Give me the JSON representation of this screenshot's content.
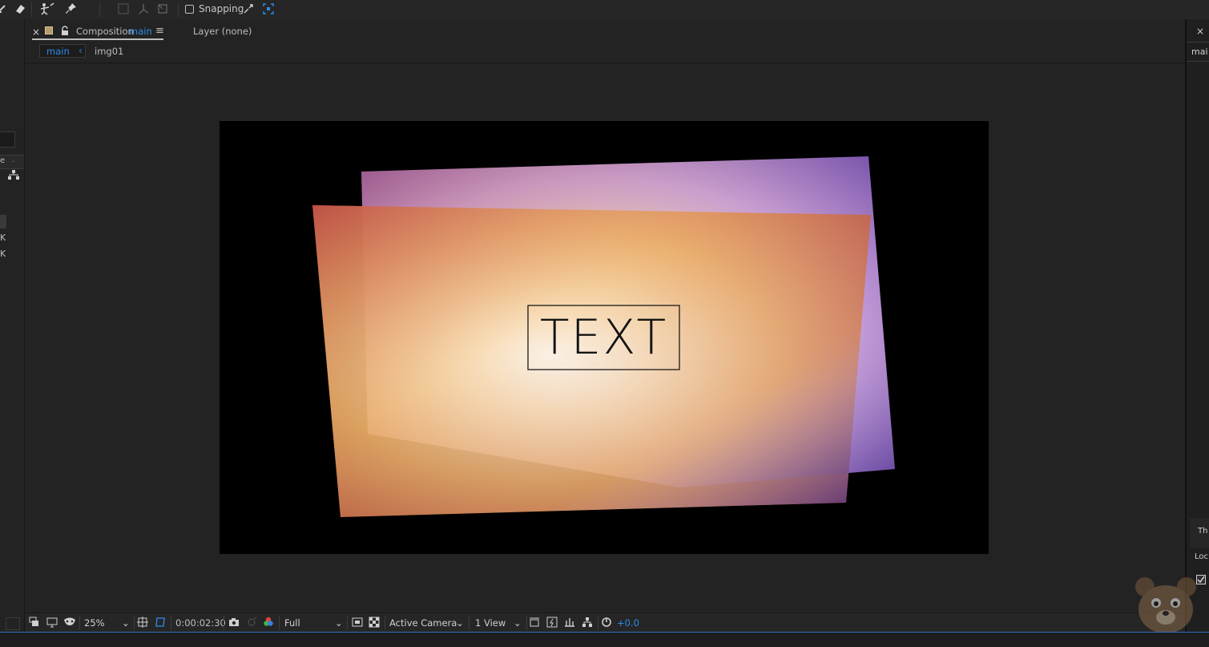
{
  "toolbar": {
    "snapping_label": "Snapping",
    "icons": [
      "pen-tool-icon",
      "eraser-icon",
      "puppet-icon",
      "pin-icon",
      "align-icon",
      "axis-icon",
      "bounding-icon",
      "snap-edge-icon",
      "snap-target-icon"
    ]
  },
  "panel": {
    "close_glyph": "×",
    "composition_prefix": "Composition",
    "composition_name": "main",
    "menu_glyph": "≡",
    "layer_label": "Layer (none)",
    "breadcrumb": [
      "main",
      "img01"
    ],
    "breadcrumb_arrow": "‹"
  },
  "left_panel": {
    "letters": [
      "e",
      "K",
      "K"
    ]
  },
  "right_panel": {
    "close_glyph": "×",
    "title": "mai",
    "label_th": "Th",
    "label_loc": "Loc"
  },
  "composition": {
    "text_layer": "TEXT",
    "background": "#000000"
  },
  "bottombar": {
    "zoom": "25%",
    "timecode": "0:00:02:30",
    "resolution": "Full",
    "camera": "Active Camera",
    "views": "1 View",
    "exposure": "+0.0"
  },
  "colors": {
    "accent": "#2d8ceb",
    "panel_bg": "#232323",
    "frame_bg": "#000000"
  }
}
